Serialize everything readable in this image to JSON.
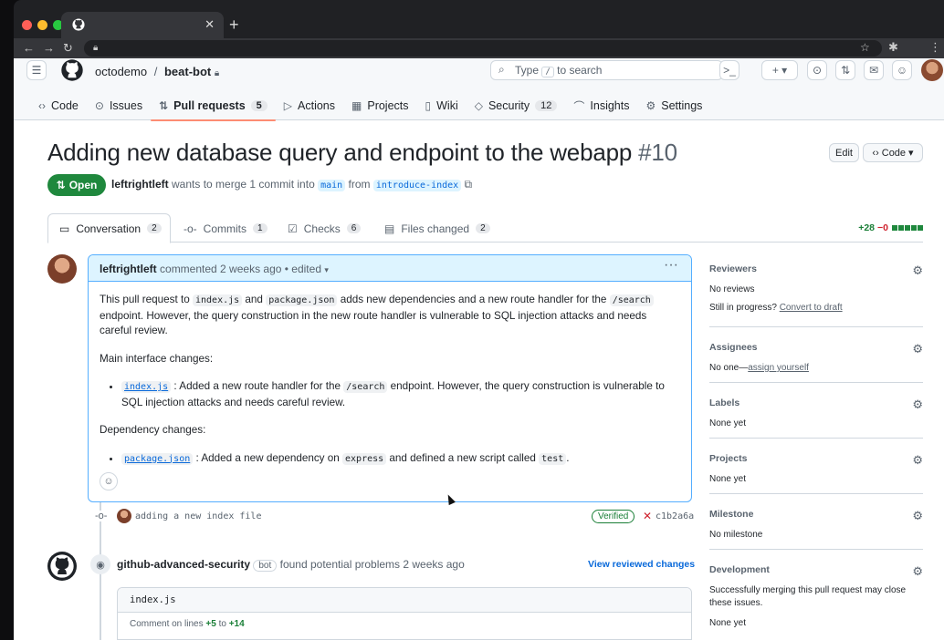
{
  "colors": {
    "accent": "#0969da",
    "open_green": "#1f883d",
    "tab_underline": "#fd8c73"
  },
  "repo": {
    "owner": "octodemo",
    "name": "beat-bot"
  },
  "search": {
    "label_pre": "Type",
    "key": "/",
    "label_post": "to search"
  },
  "nav": [
    {
      "icon": "code-icon",
      "glyph": "‹›",
      "label": "Code",
      "count": ""
    },
    {
      "icon": "issue-icon",
      "glyph": "⊙",
      "label": "Issues",
      "count": ""
    },
    {
      "icon": "pull-request-icon",
      "glyph": "⇅",
      "label": "Pull requests",
      "count": "5"
    },
    {
      "icon": "play-icon",
      "glyph": "▷",
      "label": "Actions",
      "count": ""
    },
    {
      "icon": "table-icon",
      "glyph": "▦",
      "label": "Projects",
      "count": ""
    },
    {
      "icon": "book-icon",
      "glyph": "▯",
      "label": "Wiki",
      "count": ""
    },
    {
      "icon": "shield-icon",
      "glyph": "◇",
      "label": "Security",
      "count": "12"
    },
    {
      "icon": "graph-icon",
      "glyph": "⌒",
      "label": "Insights",
      "count": ""
    },
    {
      "icon": "gear-icon",
      "glyph": "⚙",
      "label": "Settings",
      "count": ""
    }
  ],
  "pr": {
    "title": "Adding new database query and endpoint to the webapp",
    "number": "#10",
    "edit_label": "Edit",
    "code_label": "Code",
    "state": "Open",
    "author": "leftrightleft",
    "merge_text_1": "wants to merge 1 commit into",
    "base": "main",
    "from": "from",
    "head": "introduce-index"
  },
  "tabs": [
    {
      "icon": "comment-icon",
      "glyph": "▭",
      "label": "Conversation",
      "count": "2"
    },
    {
      "icon": "commit-icon",
      "glyph": "-o-",
      "label": "Commits",
      "count": "1"
    },
    {
      "icon": "checklist-icon",
      "glyph": "☑",
      "label": "Checks",
      "count": "6"
    },
    {
      "icon": "file-diff-icon",
      "glyph": "▤",
      "label": "Files changed",
      "count": "2"
    }
  ],
  "diffstat": {
    "add": "+28",
    "del": "−0"
  },
  "comment": {
    "author": "leftrightleft",
    "meta": "commented 2 weeks ago • edited",
    "p1_a": "This pull request to",
    "p1_code1": "index.js",
    "p1_b": "and",
    "p1_code2": "package.json",
    "p1_c": "adds new dependencies and a new route handler for the",
    "p1_code3": "/search",
    "p1_d": "endpoint. However, the query construction in the new route handler is vulnerable to SQL injection attacks and needs careful review.",
    "h1": "Main interface changes:",
    "li1_code": "index.js",
    "li1_a": ": Added a new route handler for the",
    "li1_code2": "/search",
    "li1_b": "endpoint. However, the query construction is vulnerable to SQL injection attacks and needs careful review.",
    "h2": "Dependency changes:",
    "li2_code": "package.json",
    "li2_a": ": Added a new dependency on",
    "li2_code2": "express",
    "li2_b": "and defined a new script called",
    "li2_code3": "test",
    "li2_c": "."
  },
  "commit": {
    "message": "adding a new index file",
    "verified": "Verified",
    "sha": "c1b2a6a"
  },
  "review": {
    "author": "github-advanced-security",
    "bot": "bot",
    "text": "found potential problems 2 weeks ago",
    "view": "View reviewed changes",
    "file": "index.js",
    "lines_pre": "Comment on lines",
    "from_line": "+5",
    "to": "to",
    "to_line": "+14"
  },
  "sidebar": {
    "reviewers": {
      "title": "Reviewers",
      "l1": "No reviews",
      "l2_pre": "Still in progress?",
      "l2_link": "Convert to draft"
    },
    "assignees": {
      "title": "Assignees",
      "pre": "No one—",
      "link": "assign yourself"
    },
    "labels": {
      "title": "Labels",
      "value": "None yet"
    },
    "projects": {
      "title": "Projects",
      "value": "None yet"
    },
    "milestone": {
      "title": "Milestone",
      "value": "No milestone"
    },
    "development": {
      "title": "Development",
      "l1": "Successfully merging this pull request may close these issues.",
      "l2": "None yet"
    }
  }
}
